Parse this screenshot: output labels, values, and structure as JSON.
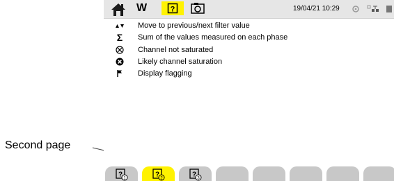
{
  "callout": {
    "label": "Second page"
  },
  "topbar": {
    "mode_label": "W",
    "datetime": "19/04/21 10:29",
    "icons": [
      "home-icon",
      "help-icon",
      "camera-icon",
      "settings-icon",
      "network-icon",
      "battery-icon"
    ]
  },
  "legend": [
    {
      "icon": "up-down-arrows-icon",
      "symbol": "▲▼",
      "text": "Move to previous/next filter value"
    },
    {
      "icon": "sigma-icon",
      "symbol": "Σ",
      "text": "Sum of the values measured on each phase"
    },
    {
      "icon": "circle-x-icon",
      "symbol": "⊗",
      "text": "Channel not saturated"
    },
    {
      "icon": "filled-circle-x-icon",
      "symbol": "✖",
      "text": "Likely channel saturation"
    },
    {
      "icon": "flag-icon",
      "symbol": "⚑",
      "text": "Display flagging"
    }
  ],
  "tabs": [
    {
      "icon": "help-page-1-icon",
      "page": "1"
    },
    {
      "icon": "help-page-2-icon",
      "page": "2",
      "active": true
    },
    {
      "icon": "help-page-3-icon",
      "page": "3"
    },
    {
      "icon": "",
      "page": ""
    },
    {
      "icon": "",
      "page": ""
    },
    {
      "icon": "",
      "page": ""
    },
    {
      "icon": "",
      "page": ""
    },
    {
      "icon": "",
      "page": ""
    }
  ],
  "colors": {
    "active_tab": "#fff200",
    "tab": "#c8c8c8",
    "topbar": "#e6e6e6",
    "callout_line": "#cc0000"
  }
}
